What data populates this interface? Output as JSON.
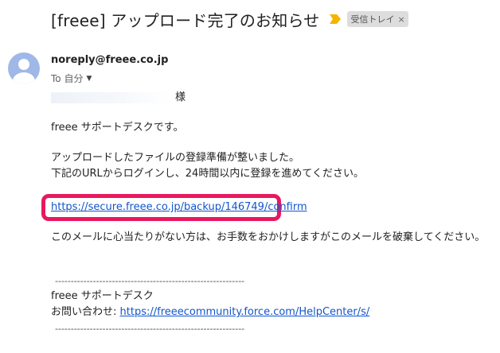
{
  "email": {
    "subject": "[freee] アップロード完了のお知らせ",
    "label": "受信トレイ",
    "label_close": "×",
    "sender": "noreply@freee.co.jp",
    "to_label": "To 自分",
    "colors": {
      "highlight": "#e8185f",
      "link": "#1155cc",
      "important": "#f4b400"
    }
  },
  "body": {
    "salutation_suffix": "様",
    "greeting": "freee サポートデスクです。",
    "line1": "アップロードしたファイルの登録準備が整いました。",
    "line2": "下記のURLからログインし、24時間以内に登録を進めてください。",
    "confirm_link": "https://secure.freee.co.jp/backup/146749/confirm",
    "disclaimer": "このメールに心当たりがない方は、お手数をおかけしますがこのメールを破棄してください。",
    "divider": "------------------------------------------------------------",
    "signature_name": "freee サポートデスク",
    "contact_label": "お問い合わせ: ",
    "contact_link": "https://freeecommunity.force.com/HelpCenter/s/"
  }
}
